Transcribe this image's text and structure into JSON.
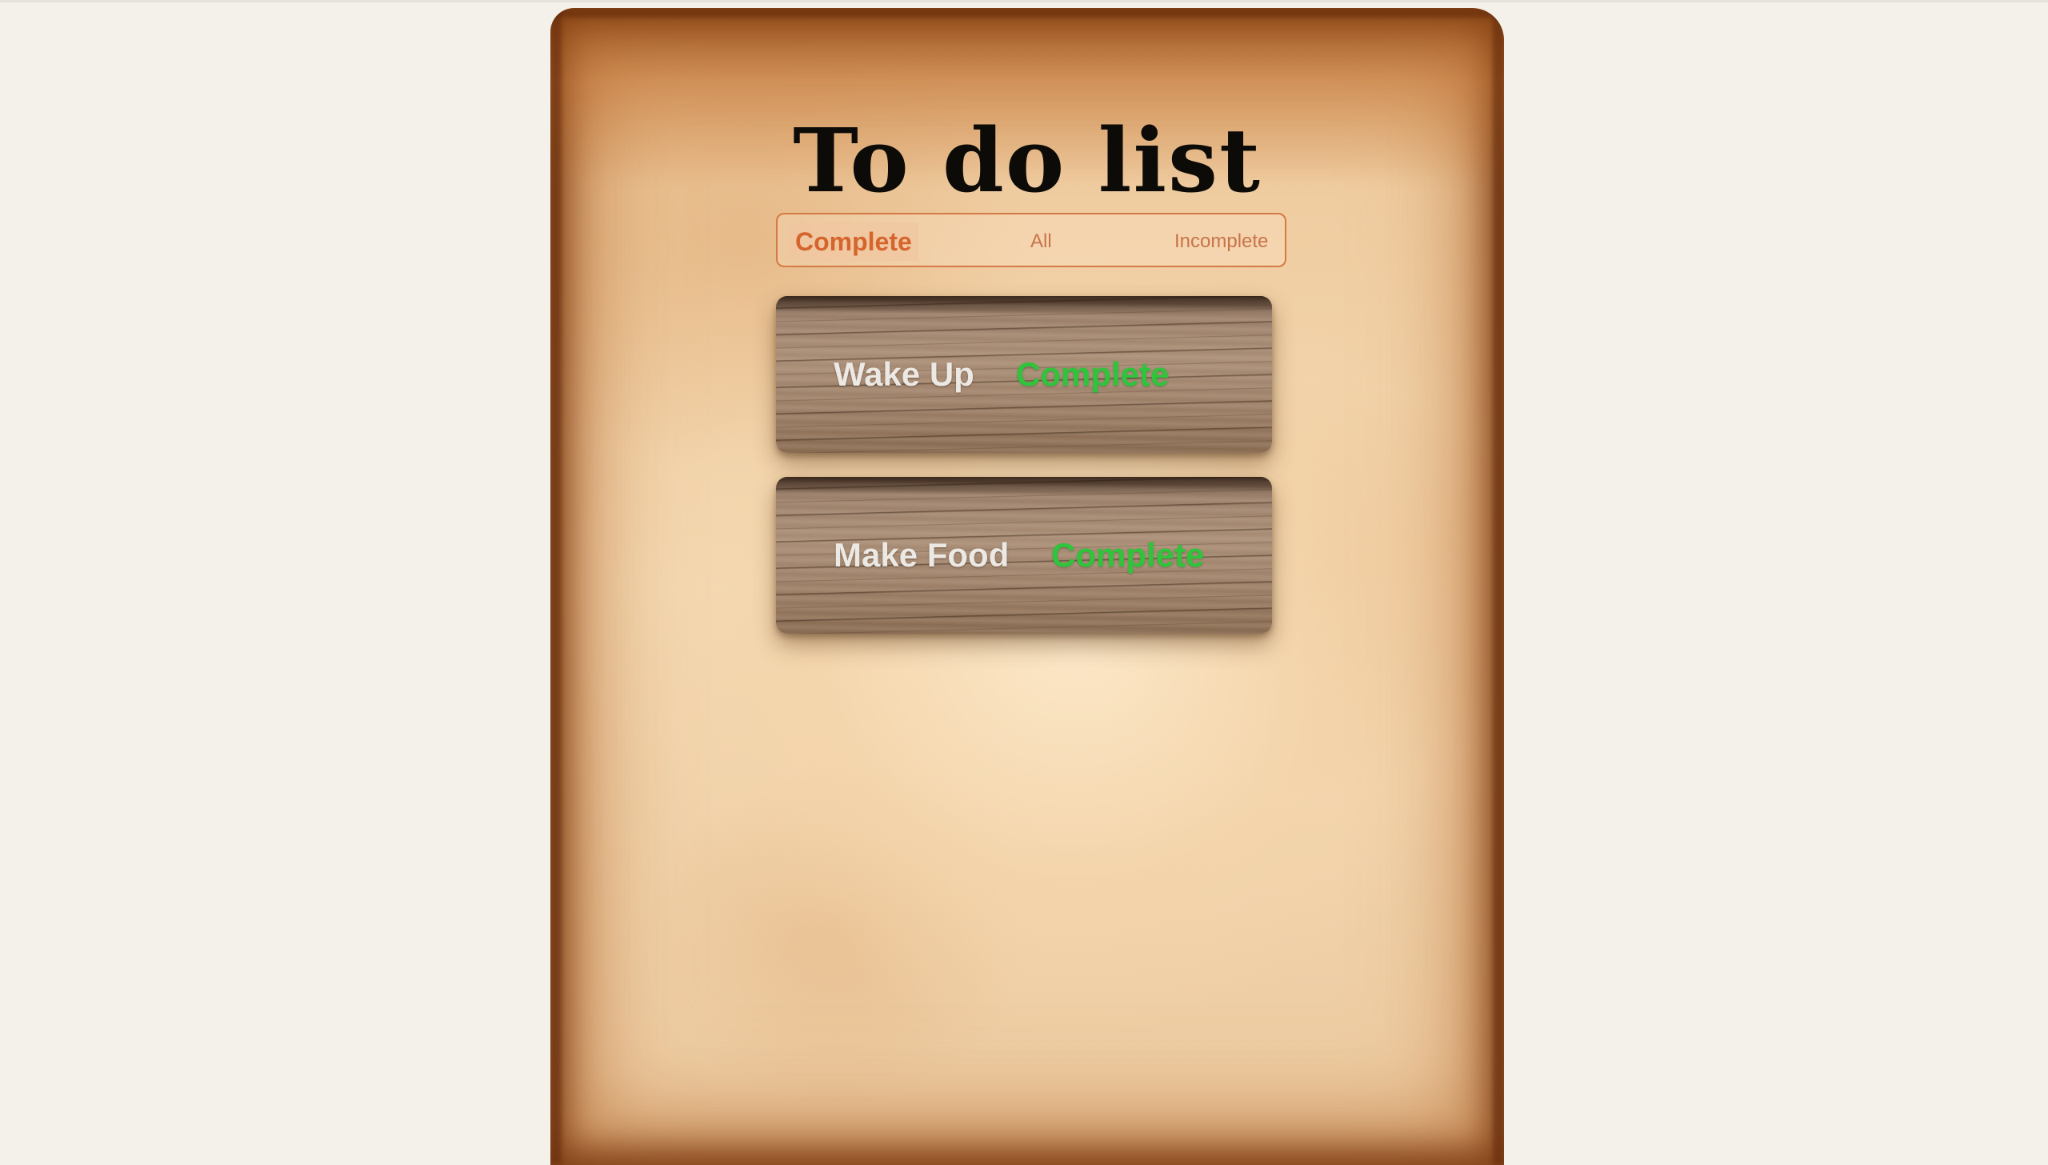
{
  "page": {
    "title": "To do list"
  },
  "filters": {
    "options": [
      {
        "label": "Complete",
        "active": true
      },
      {
        "label": "All",
        "active": false
      },
      {
        "label": "Incomplete",
        "active": false
      }
    ]
  },
  "todos": [
    {
      "name": "Wake Up",
      "status": "Complete"
    },
    {
      "name": "Make Food",
      "status": "Complete"
    }
  ],
  "colors": {
    "status_complete": "#2fc43b",
    "filter_accent": "#d57a44"
  }
}
